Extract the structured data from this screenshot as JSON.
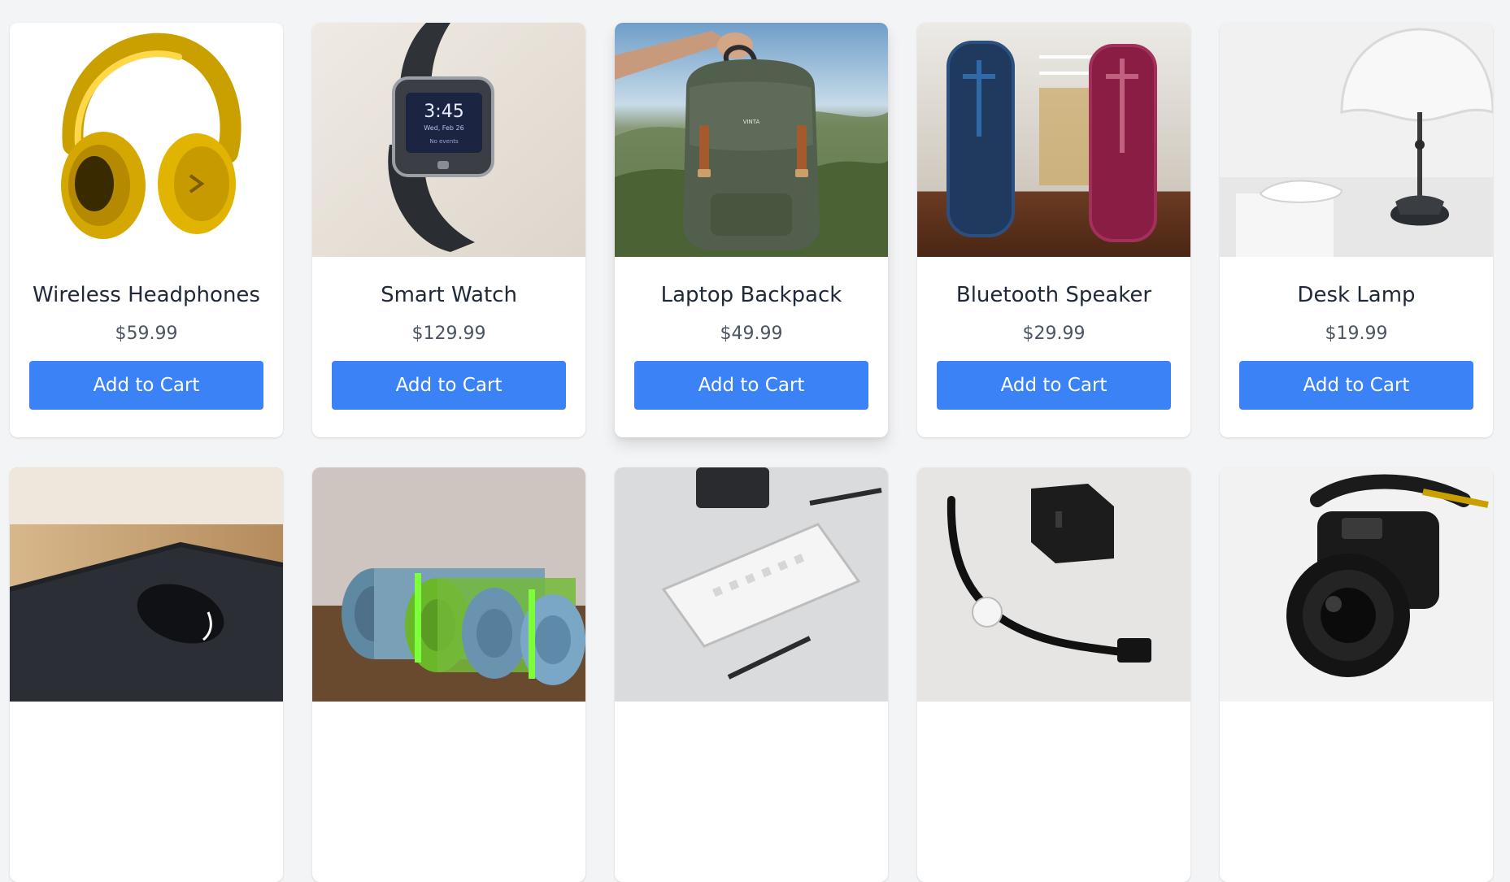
{
  "products": [
    {
      "name": "Wireless Headphones",
      "price": "$59.99",
      "button": "Add to Cart",
      "image_icon": "headphones-icon"
    },
    {
      "name": "Smart Watch",
      "price": "$129.99",
      "button": "Add to Cart",
      "image_icon": "smartwatch-icon"
    },
    {
      "name": "Laptop Backpack",
      "price": "$49.99",
      "button": "Add to Cart",
      "image_icon": "backpack-icon"
    },
    {
      "name": "Bluetooth Speaker",
      "price": "$29.99",
      "button": "Add to Cart",
      "image_icon": "speaker-icon"
    },
    {
      "name": "Desk Lamp",
      "price": "$19.99",
      "button": "Add to Cart",
      "image_icon": "lamp-icon"
    },
    {
      "image_icon": "mouse-icon"
    },
    {
      "image_icon": "yoga-mat-icon"
    },
    {
      "image_icon": "keyboard-icon"
    },
    {
      "image_icon": "charger-icon"
    },
    {
      "image_icon": "camera-icon"
    }
  ],
  "colors": {
    "page_bg": "#f3f4f6",
    "card_bg": "#ffffff",
    "button_bg": "#3b82f6",
    "button_text": "#ffffff",
    "title_text": "#1f2937",
    "price_text": "#4b5563"
  },
  "watch_screen": {
    "time": "3:45",
    "date": "Wed, Feb 26",
    "status": "No events"
  },
  "backpack_brand": "VINTA"
}
